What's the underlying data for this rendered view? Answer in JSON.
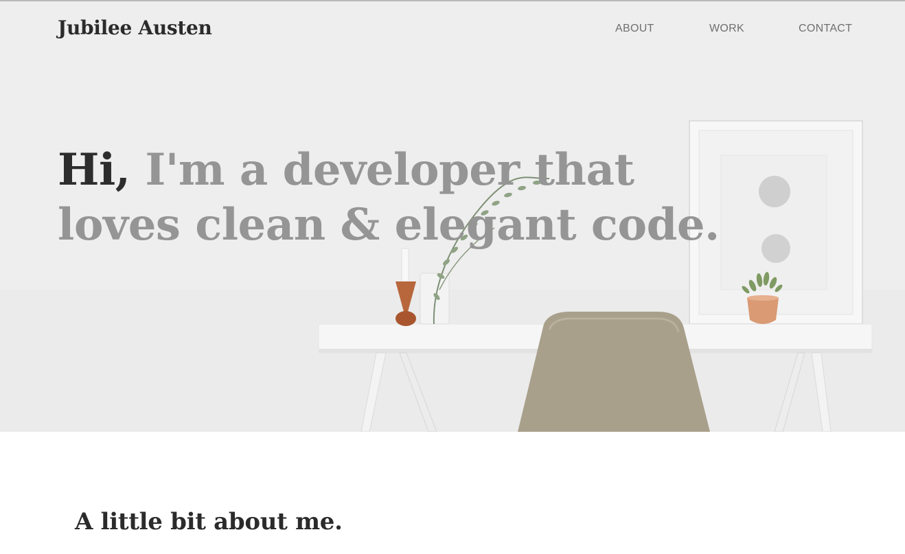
{
  "header": {
    "brand": "Jubilee Austen",
    "nav": [
      {
        "label": "ABOUT"
      },
      {
        "label": "WORK"
      },
      {
        "label": "CONTACT"
      }
    ]
  },
  "hero": {
    "greeting": "Hi,",
    "tagline": " I'm a developer that loves clean & elegant code."
  },
  "about": {
    "title": "A little bit about me."
  },
  "colors": {
    "text_dark": "#2d2d2d",
    "text_muted": "#959595",
    "nav_text": "#6f6f6f",
    "chair": "#a9a08c",
    "copper": "#d99a74",
    "wood": "#b8673c"
  }
}
